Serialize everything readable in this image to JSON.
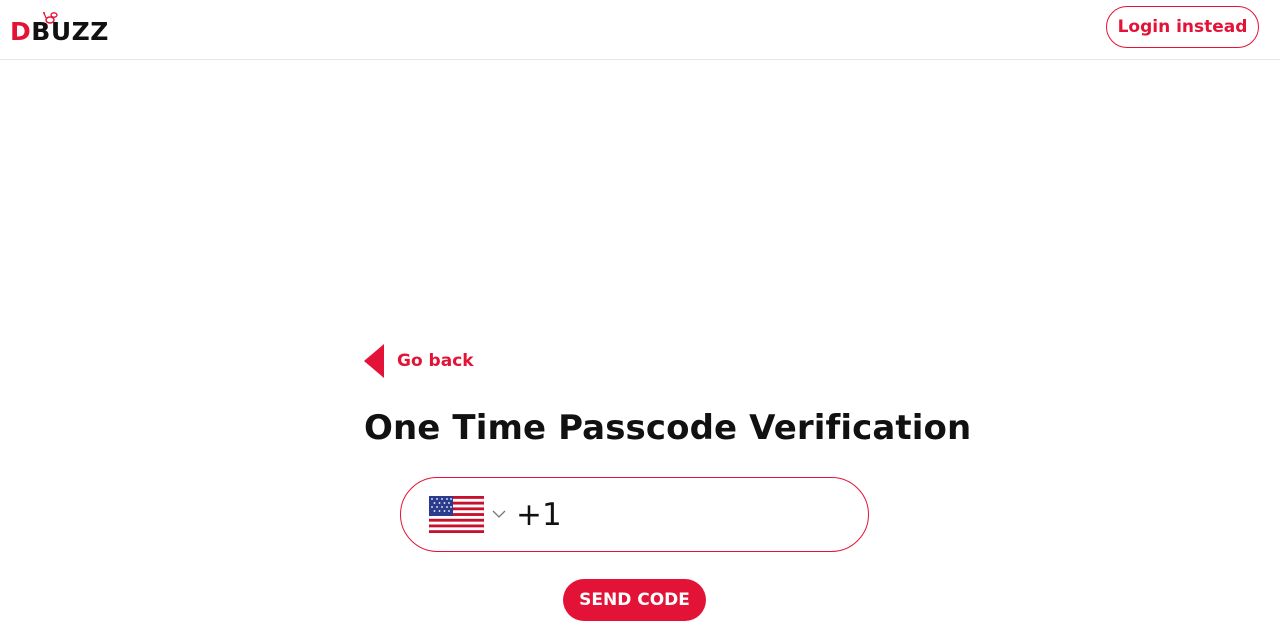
{
  "header": {
    "logo_first": "D",
    "logo_rest": "BUZZ",
    "login_label": "Login instead"
  },
  "main": {
    "go_back_label": "Go back",
    "title": "One Time Passcode Verification",
    "phone": {
      "country_flag": "us-flag-icon",
      "dial_code": "+1",
      "value": ""
    },
    "send_code_label": "SEND CODE"
  },
  "colors": {
    "accent": "#e31337",
    "text": "#111111",
    "background": "#ffffff"
  }
}
